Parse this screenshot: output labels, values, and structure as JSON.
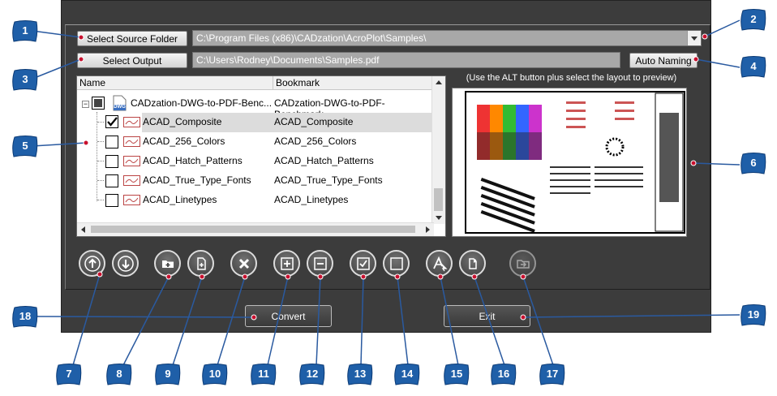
{
  "buttons": {
    "select_source": "Select Source Folder",
    "select_output": "Select Output",
    "auto_naming": "Auto Naming",
    "convert": "Convert",
    "exit": "Exit"
  },
  "fields": {
    "source_path": "C:\\Program Files (x86)\\CADzation\\AcroPlot\\Samples\\",
    "output_path": "C:\\Users\\Rodney\\Documents\\Samples.pdf"
  },
  "tree": {
    "columns": [
      "Name",
      "Bookmark"
    ],
    "root": {
      "name": "CADzation-DWG-to-PDF-Benc...",
      "bookmark": "CADzation-DWG-to-PDF-Benchmark",
      "icon_label": "DWG"
    },
    "items": [
      {
        "name": "ACAD_Composite",
        "bookmark": "ACAD_Composite",
        "checked": true,
        "selected": true
      },
      {
        "name": "ACAD_256_Colors",
        "bookmark": "ACAD_256_Colors",
        "checked": false
      },
      {
        "name": "ACAD_Hatch_Patterns",
        "bookmark": "ACAD_Hatch_Patterns",
        "checked": false
      },
      {
        "name": "ACAD_True_Type_Fonts",
        "bookmark": "ACAD_True_Type_Fonts",
        "checked": false
      },
      {
        "name": "ACAD_Linetypes",
        "bookmark": "ACAD_Linetypes",
        "checked": false
      }
    ]
  },
  "preview": {
    "hint": "(Use the ALT button plus select the layout to preview)"
  },
  "callouts": [
    "1",
    "2",
    "3",
    "4",
    "5",
    "6",
    "7",
    "8",
    "9",
    "10",
    "11",
    "12",
    "13",
    "14",
    "15",
    "16",
    "17",
    "18",
    "19"
  ],
  "colors": {
    "panel": "#3c3c3c",
    "callout": "#1f5fa8",
    "leader": "#2a5aa0",
    "dot": "#c8102e"
  }
}
